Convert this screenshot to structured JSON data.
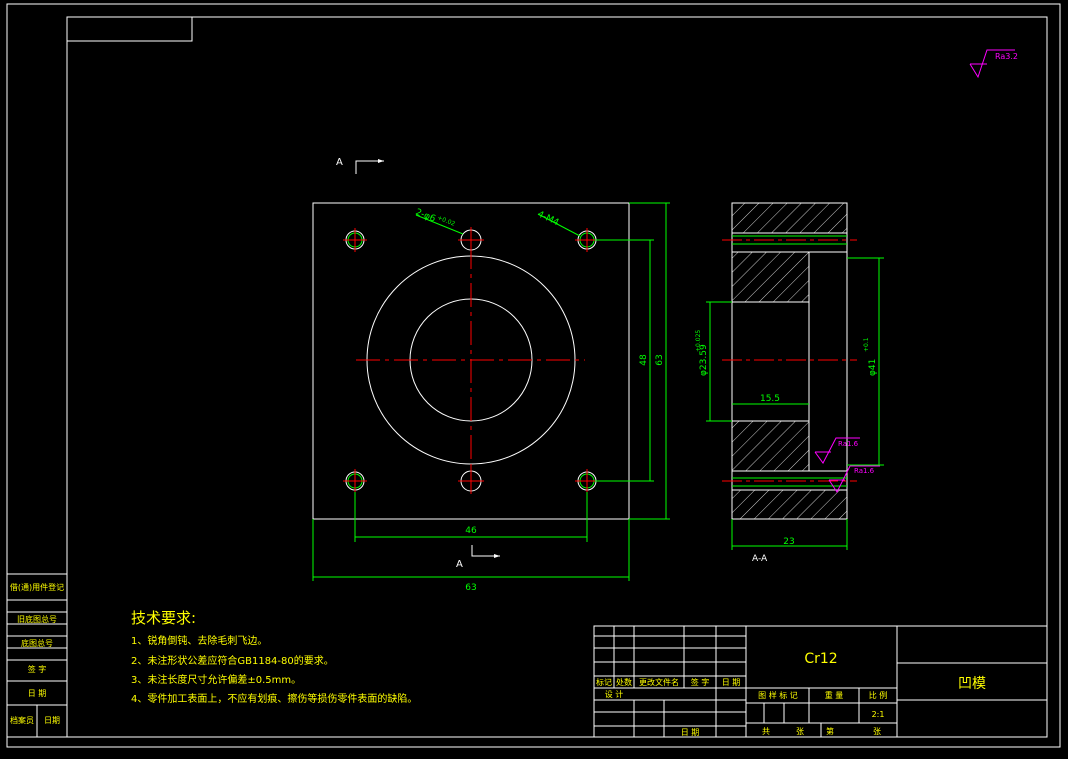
{
  "colors": {
    "background": "#000000",
    "lines": "#ffffff",
    "dimensions": "#00ff00",
    "centerlines": "#ff0000",
    "notes": "#ffff00",
    "roughness": "#ff00ff"
  },
  "section_marks": {
    "top": "A",
    "bottom": "A",
    "view_label": "A-A"
  },
  "front_view": {
    "dim_width_outer": "63",
    "dim_width_holes": "46",
    "dim_height_holes": "48",
    "dim_height_outer": "63",
    "label_pins": "2-φ6",
    "label_pins_tol": "+0.02",
    "label_threads": "4-M4"
  },
  "section_view": {
    "dim_bore": "φ23.59",
    "dim_bore_tol": "+0.025",
    "dim_step": "15.5",
    "dim_counterbore": "φ41",
    "dim_counterbore_tol": "+0.1",
    "dim_thickness": "23",
    "roughness_1": "Ra1.6",
    "roughness_2": "Ra1.6"
  },
  "roughness_general": "Ra3.2",
  "notes": {
    "title": "技术要求:",
    "items": [
      "1、锐角倒钝、去除毛刺飞边。",
      "2、未注形状公差应符合GB1184-80的要求。",
      "3、未注长度尺寸允许偏差±0.5mm。",
      "4、零件加工表面上，不应有划痕、擦伤等损伤零件表面的缺陷。"
    ]
  },
  "left_strip": {
    "cells": [
      "借(通)用件登记",
      "旧底图总号",
      "底图总号",
      "签 字",
      "日 期"
    ],
    "bottom_left": "档案员",
    "bottom_right": "日期"
  },
  "title_block": {
    "material": "Cr12",
    "part_name": "凹模",
    "rev_headers": [
      "标记",
      "处数",
      "更改文件名",
      "签 字",
      "日 期"
    ],
    "design_label": "设 计",
    "date_label": "日 期",
    "attr_headers": [
      "图 样 标 记",
      "重 量",
      "比 例"
    ],
    "scale": "2:1",
    "sheets_total": "共",
    "sheets_total_unit": "张",
    "sheet_no": "第",
    "sheet_no_unit": "张"
  }
}
